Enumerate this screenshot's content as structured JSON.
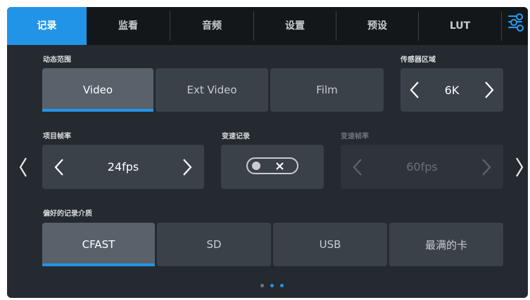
{
  "tabs": [
    {
      "label": "记录",
      "active": true
    },
    {
      "label": "监看",
      "active": false
    },
    {
      "label": "音频",
      "active": false
    },
    {
      "label": "设置",
      "active": false
    },
    {
      "label": "预设",
      "active": false
    },
    {
      "label": "LUT",
      "active": false
    }
  ],
  "settings_icon": "sliders-icon",
  "dynamic_range": {
    "label": "动态范围",
    "options": [
      "Video",
      "Ext Video",
      "Film"
    ],
    "selected": "Video"
  },
  "sensor_area": {
    "label": "传感器区域",
    "value": "6K"
  },
  "project_frame_rate": {
    "label": "项目帧率",
    "value": "24fps"
  },
  "off_speed_recording": {
    "label": "变速记录",
    "enabled": false
  },
  "off_speed_frame_rate": {
    "label": "变速帧率",
    "value": "60fps",
    "disabled": true
  },
  "preferred_media": {
    "label": "偏好的记录介质",
    "options": [
      "CFAST",
      "SD",
      "USB",
      "最满的卡"
    ],
    "selected": "CFAST"
  },
  "pagination": {
    "pages": 3,
    "current": 1
  },
  "colors": {
    "accent": "#2294e8",
    "panel": "#252a30",
    "tabbar": "#14171a",
    "button": "#3a4149",
    "button_selected": "#59616b"
  }
}
